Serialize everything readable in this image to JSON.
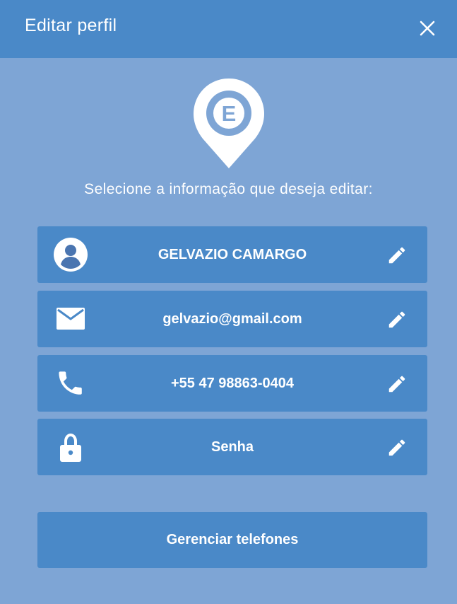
{
  "header": {
    "title": "Editar perfil",
    "close_icon": "close-icon"
  },
  "logo": {
    "letter": "E",
    "icon": "map-pin-logo"
  },
  "prompt": "Selecione a informação que deseja editar:",
  "fields": [
    {
      "icon": "account-circle-icon",
      "label": "GELVAZIO CAMARGO",
      "action_icon": "pencil-icon"
    },
    {
      "icon": "email-icon",
      "label": "gelvazio@gmail.com",
      "action_icon": "pencil-icon"
    },
    {
      "icon": "phone-icon",
      "label": "+55 47 98863-0404",
      "action_icon": "pencil-icon"
    },
    {
      "icon": "lock-icon",
      "label": "Senha",
      "action_icon": "pencil-icon"
    }
  ],
  "manage_phones_label": "Gerenciar telefones",
  "colors": {
    "background": "#7ea5d5",
    "header": "#4a89c8",
    "button": "#4a89c8",
    "text": "#ffffff"
  }
}
